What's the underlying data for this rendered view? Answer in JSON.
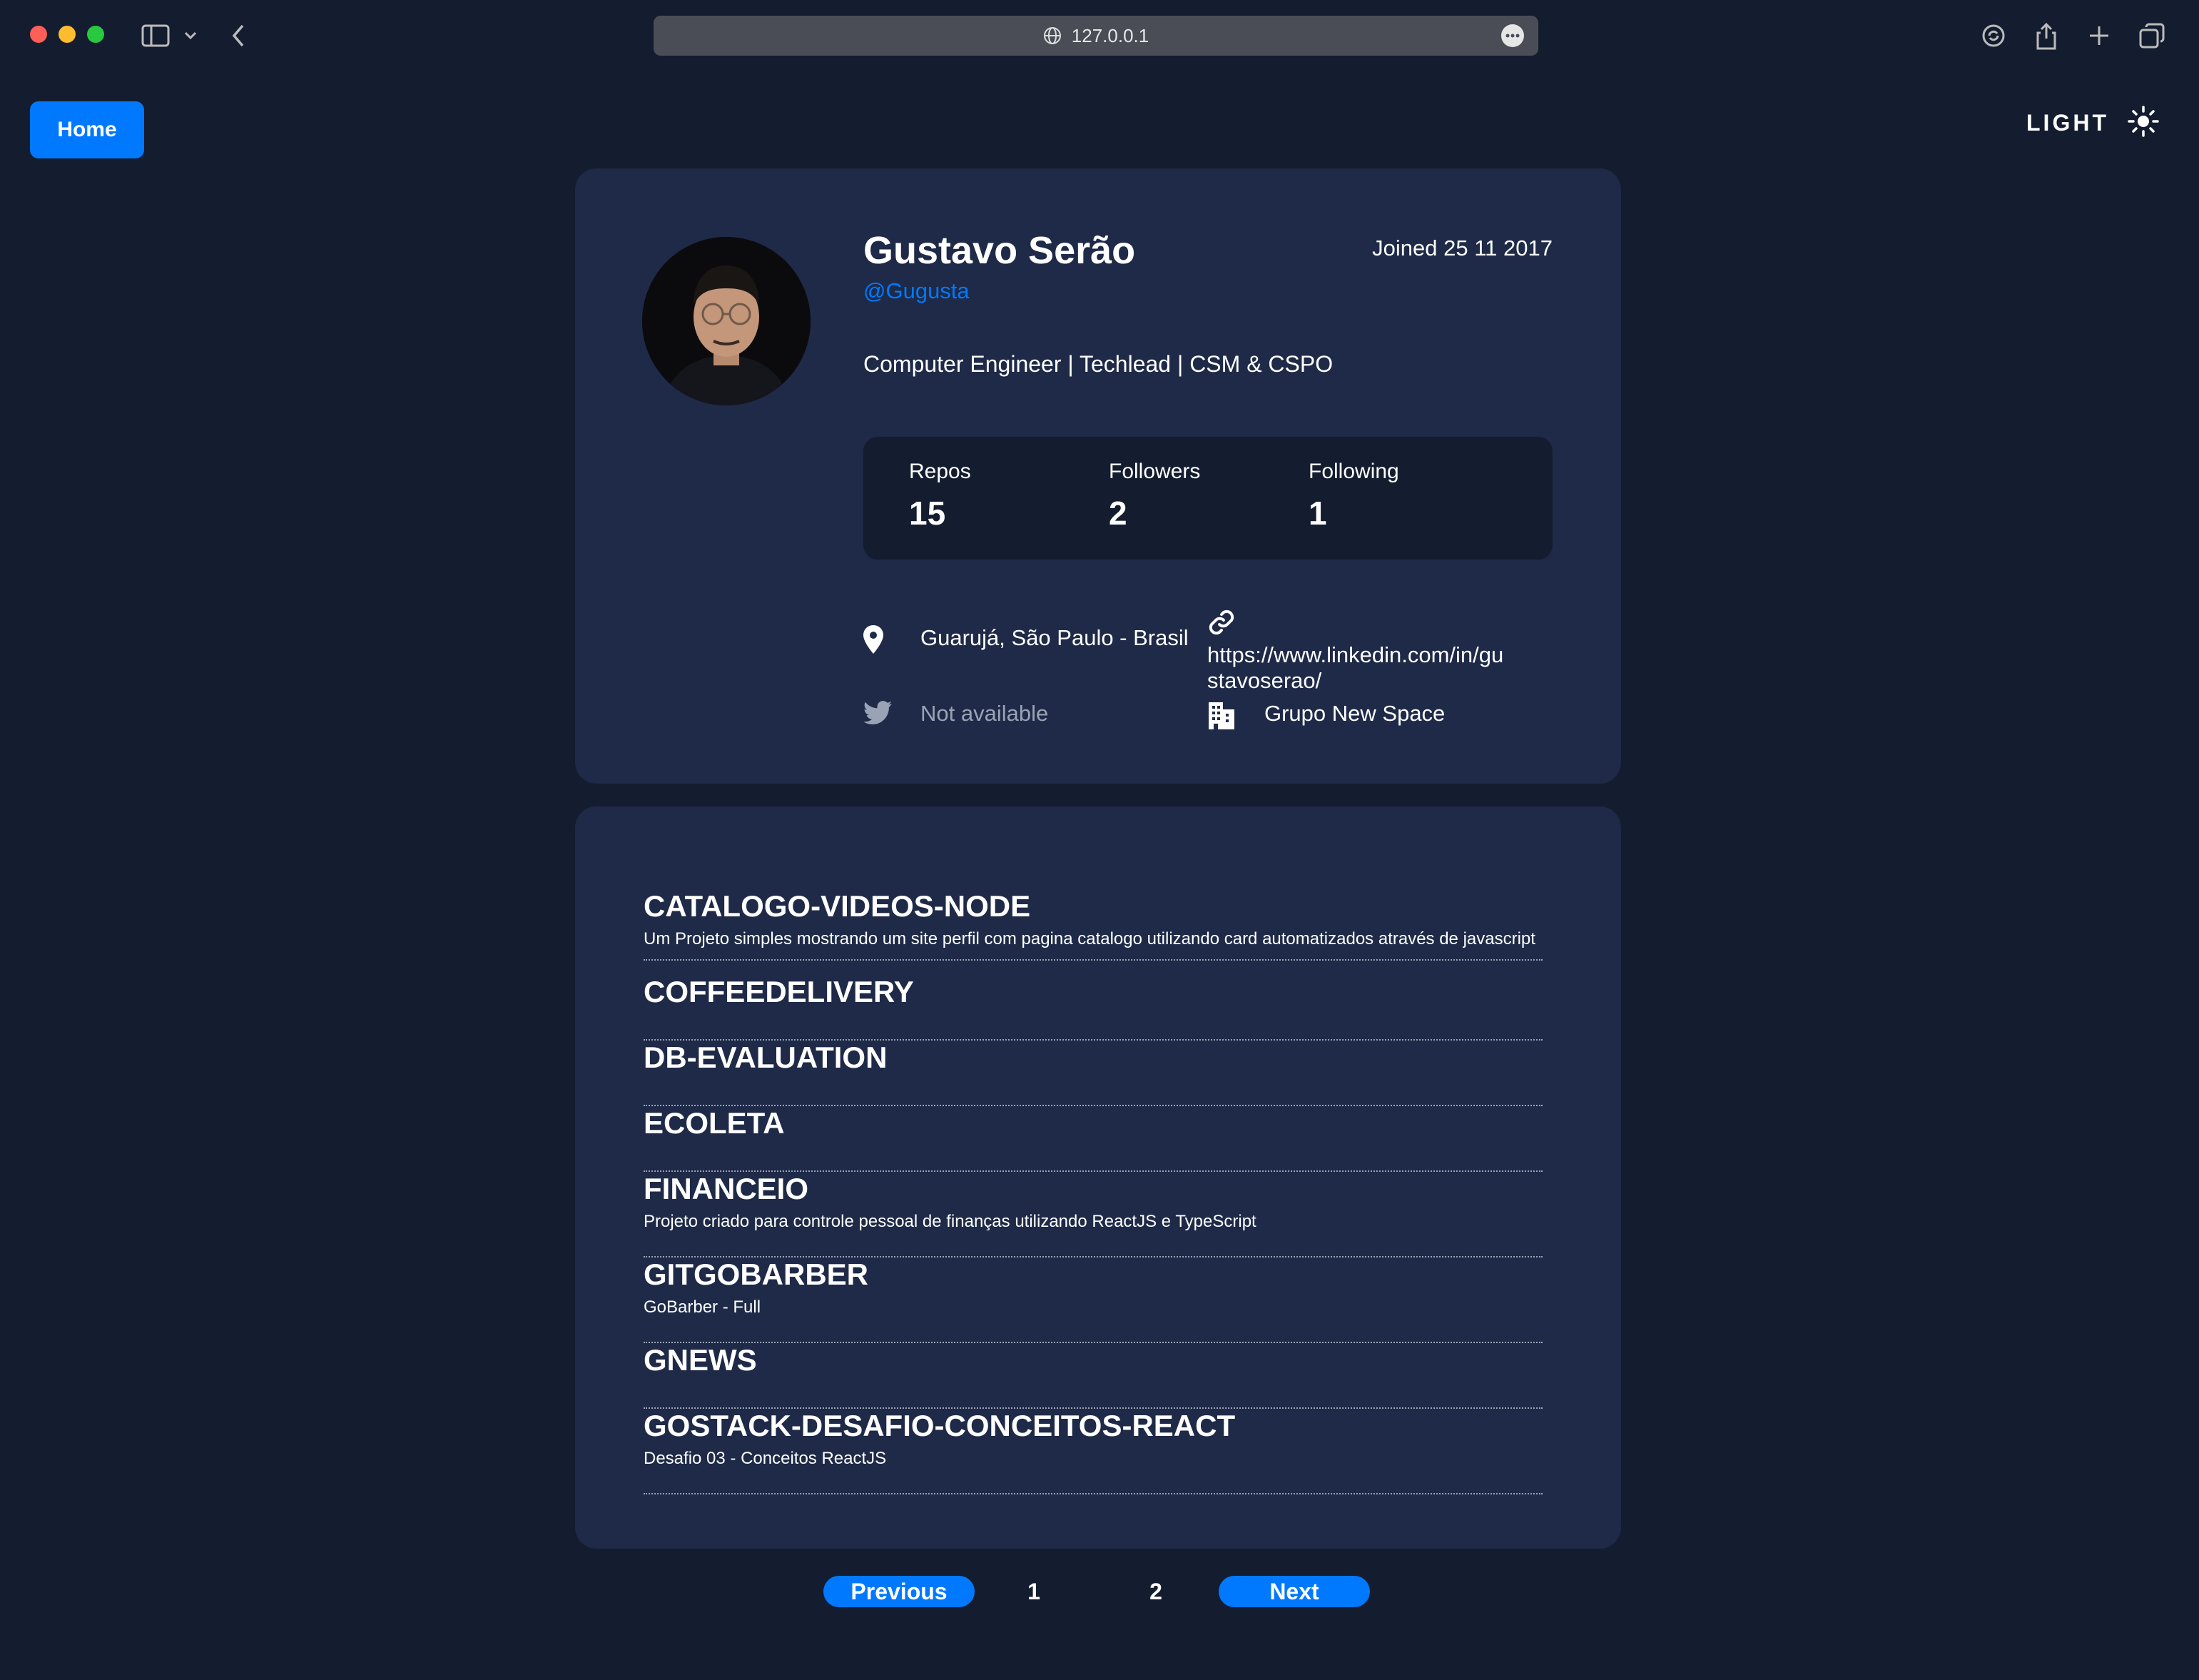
{
  "browser": {
    "url": "127.0.0.1"
  },
  "header": {
    "home_label": "Home",
    "theme_label": "LIGHT",
    "theme_icon": "sun-icon"
  },
  "profile": {
    "name": "Gustavo Serão",
    "login": "@Gugusta",
    "joined": "Joined 25 11 2017",
    "bio": "Computer Engineer | Techlead | CSM & CSPO",
    "stats": {
      "repos_label": "Repos",
      "repos": "15",
      "followers_label": "Followers",
      "followers": "2",
      "following_label": "Following",
      "following": "1"
    },
    "location": "Guarujá, São Paulo - Brasil",
    "blog_line1": "https://www.linkedin.com/in/gu",
    "blog_line2": "stavoserao/",
    "twitter": "Not available",
    "company": "Grupo New Space"
  },
  "repos": [
    {
      "name": "CATALOGO-VIDEOS-NODE",
      "description": "Um Projeto simples mostrando um site perfil com pagina catalogo utilizando card automatizados através de javascript"
    },
    {
      "name": "COFFEEDELIVERY",
      "description": ""
    },
    {
      "name": "DB-EVALUATION",
      "description": ""
    },
    {
      "name": "ECOLETA",
      "description": ""
    },
    {
      "name": "FINANCEIO",
      "description": "Projeto criado para controle pessoal de finanças utilizando ReactJS e TypeScript"
    },
    {
      "name": "GITGOBARBER",
      "description": "GoBarber - Full"
    },
    {
      "name": "GNEWS",
      "description": ""
    },
    {
      "name": "GOSTACK-DESAFIO-CONCEITOS-REACT",
      "description": "Desafio 03 - Conceitos ReactJS"
    }
  ],
  "pagination": {
    "previous": "Previous",
    "page1": "1",
    "page2": "2",
    "next": "Next"
  },
  "colors": {
    "background": "#141d2f",
    "card": "#1e2a47",
    "accent": "#0079ff"
  }
}
